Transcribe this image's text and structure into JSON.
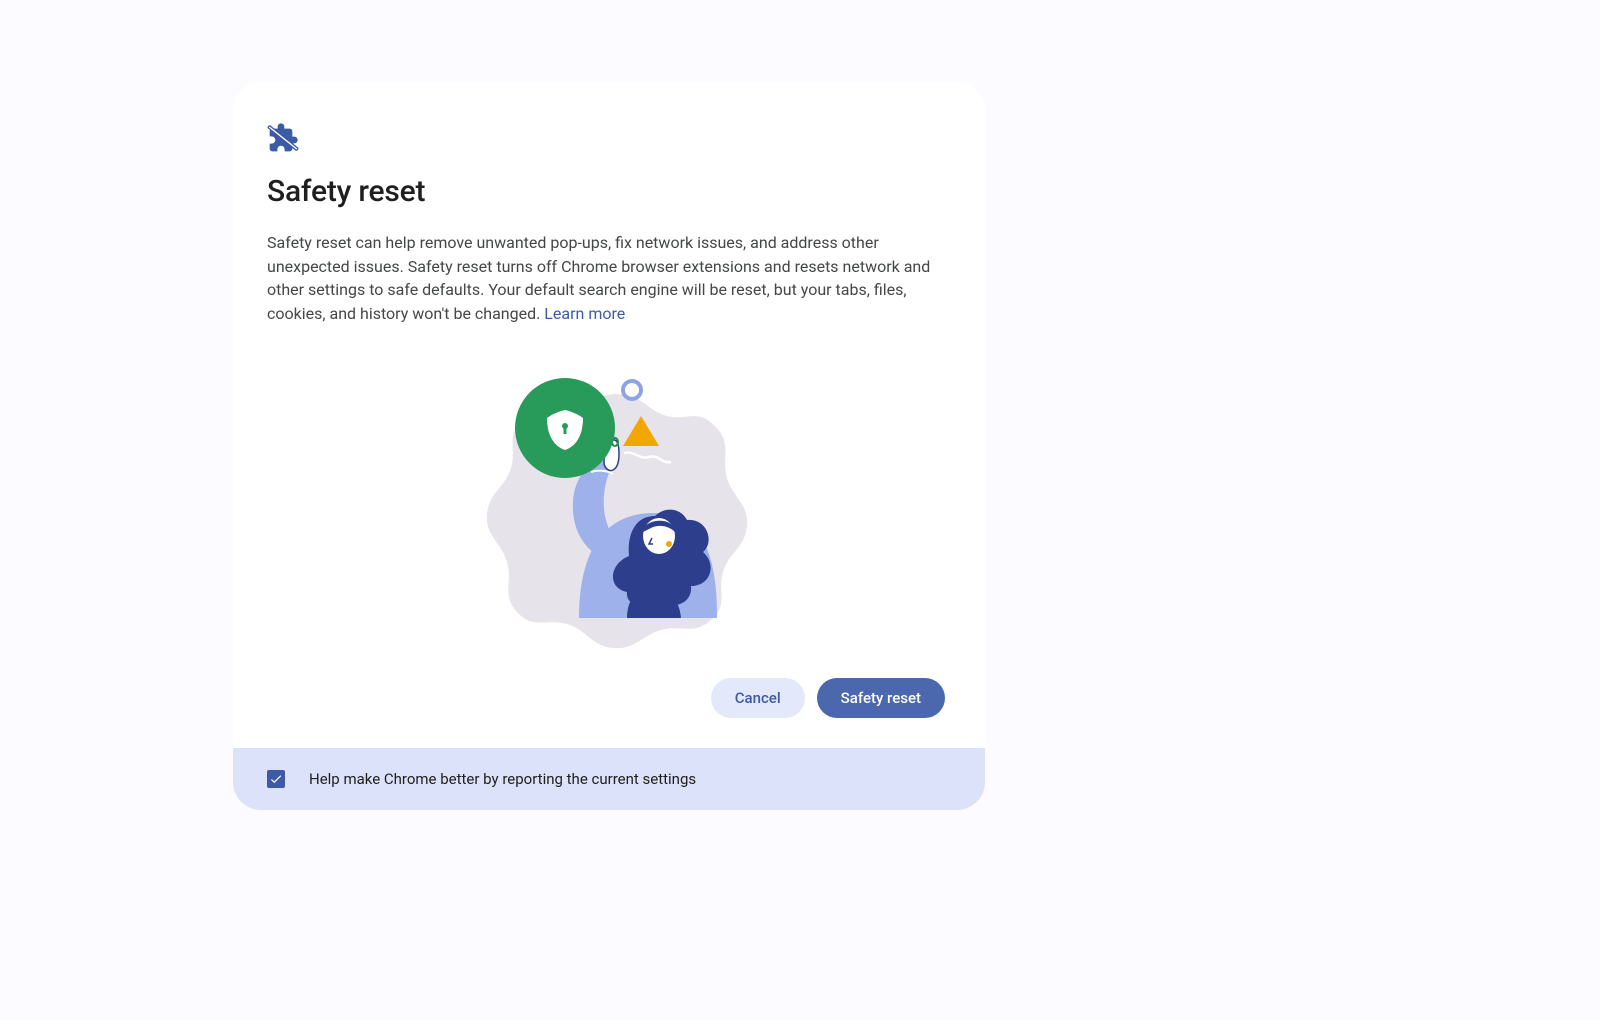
{
  "dialog": {
    "title": "Safety reset",
    "description": "Safety reset can help remove unwanted pop-ups, fix network issues, and address other unexpected issues. Safety reset turns off Chrome browser extensions and resets network and other settings to safe defaults. Your default search engine will be reset, but your tabs, files, cookies, and history won't be changed. ",
    "learn_more": "Learn more",
    "cancel_label": "Cancel",
    "confirm_label": "Safety reset"
  },
  "footer": {
    "checkbox_checked": true,
    "checkbox_label": "Help make Chrome better by reporting the current settings"
  },
  "colors": {
    "primary": "#4B67AD",
    "secondary_bg": "#E3E8FA",
    "footer_bg": "#DBE2F9",
    "link": "#3C5AA6",
    "green": "#1E8E3E",
    "yellow": "#F2A600"
  }
}
